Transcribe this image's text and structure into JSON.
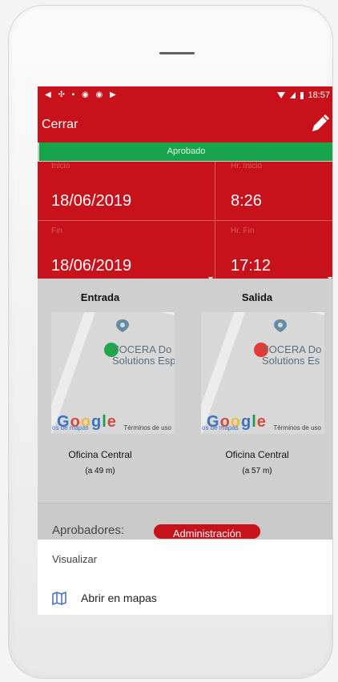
{
  "statusbar": {
    "left_icons": "◀ ✣ ▪ ◉ ◉ ▶",
    "time": "18:57"
  },
  "appbar": {
    "close_label": "Cerrar"
  },
  "status": {
    "approved_label": "Aprobado"
  },
  "start_date": {
    "label": "Inicio",
    "value": "18/06/2019"
  },
  "start_time": {
    "label": "Hr. Inicio",
    "value": "8:26"
  },
  "end_date": {
    "label": "Fin",
    "value": "18/06/2019"
  },
  "end_time": {
    "label": "Hr. Fin",
    "value": "17:12"
  },
  "entry": {
    "title": "Entrada",
    "map_label_line1": "YOCERA Do",
    "map_label_line2": "Solutions Esp",
    "footer_left": "os de mapas",
    "footer_right": "Términos de uso",
    "place": "Oficina Central",
    "distance": "(a 49 m)",
    "dot_color": "#1fa84a"
  },
  "exit": {
    "title": "Salida",
    "map_label_line1": "YOCERA Do",
    "map_label_line2": "Solutions Es",
    "footer_left": "os de mapas",
    "footer_right": "Términos de uso",
    "place": "Oficina Central",
    "distance": "(a 57 m)",
    "dot_color": "#e83a35"
  },
  "approvers": {
    "label": "Aprobadores:",
    "chip": "Administración"
  },
  "bottom_sheet": {
    "title": "Visualizar",
    "open_in_maps": "Abrir en mapas"
  },
  "colors": {
    "primary_red": "#c8121b",
    "success_green": "#18a44c",
    "link_blue": "#3f6fca"
  },
  "icons": {
    "edit": "pencil-icon",
    "map": "map-icon",
    "dropdown": "triangle-down-icon"
  }
}
